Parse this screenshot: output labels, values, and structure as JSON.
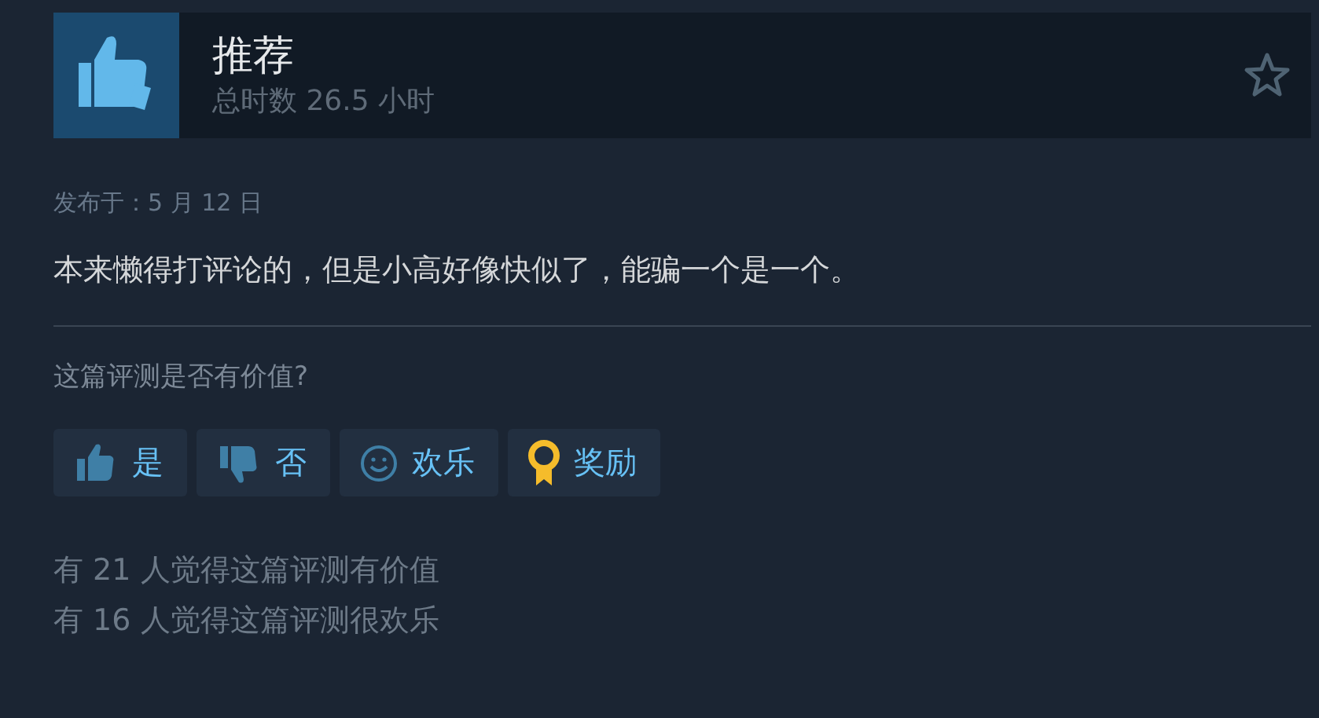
{
  "header": {
    "title": "推荐",
    "playtime": "总时数 26.5 小时"
  },
  "posted": "发布于：5 月 12 日",
  "review": "本来懒得打评论的，但是小高好像快似了，能骗一个是一个。",
  "question": "这篇评测是否有价值?",
  "buttons": [
    {
      "kind": "yes",
      "label": "是"
    },
    {
      "kind": "no",
      "label": "否"
    },
    {
      "kind": "funny",
      "label": "欢乐"
    },
    {
      "kind": "award",
      "label": "奖励"
    }
  ],
  "counts": [
    "有 21 人觉得这篇评测有价值",
    "有 16 人觉得这篇评测很欢乐"
  ]
}
